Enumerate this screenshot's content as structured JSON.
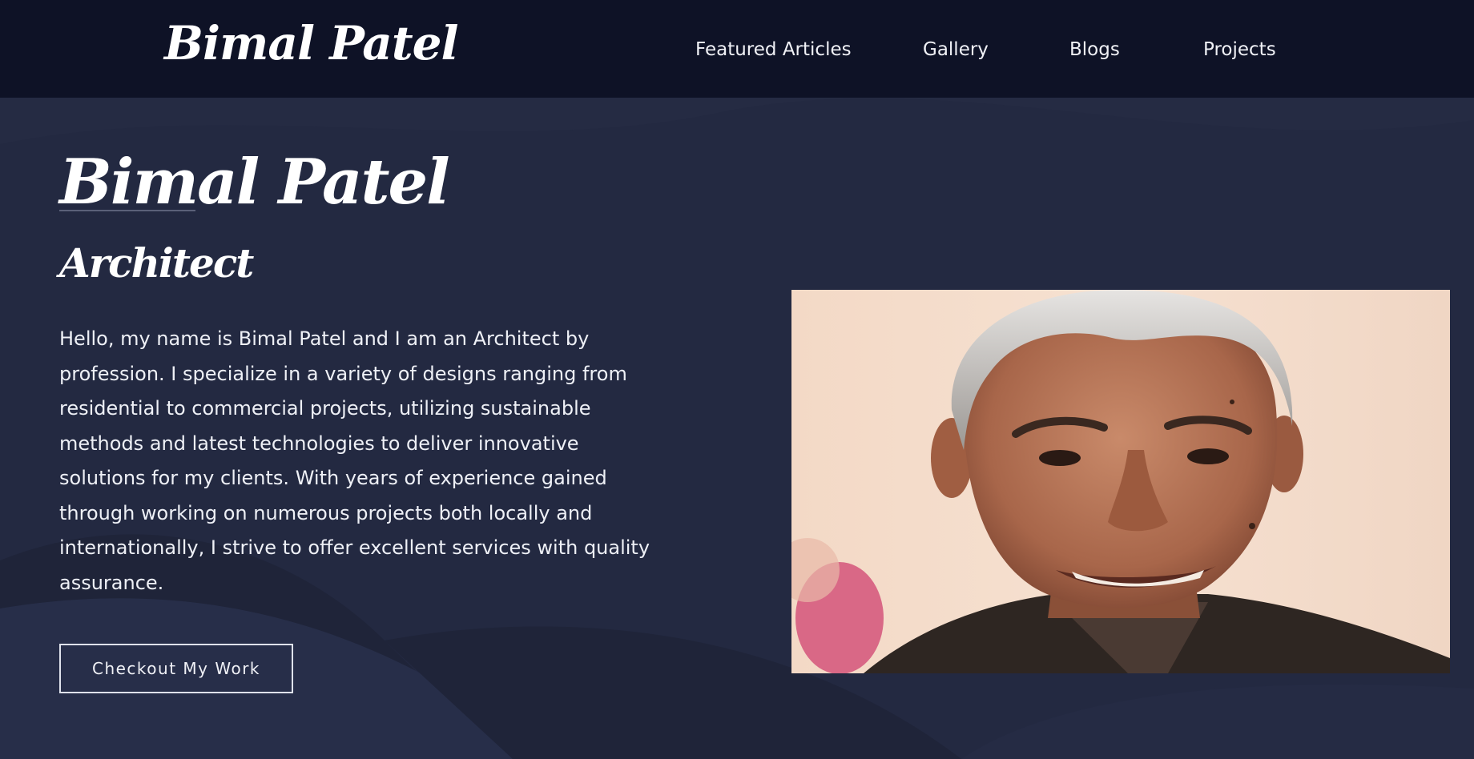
{
  "header": {
    "brand": "Bimal Patel",
    "nav": [
      {
        "label": "Featured Articles"
      },
      {
        "label": "Gallery"
      },
      {
        "label": "Blogs"
      },
      {
        "label": "Projects"
      }
    ]
  },
  "hero": {
    "name": "Bimal Patel",
    "role": "Architect",
    "bio": "Hello, my name is Bimal Patel and I am an Architect by profession. I specialize in a variety of designs ranging from residential to commercial projects, utilizing sustainable methods and latest technologies to deliver innovative solutions for my clients. With years of experience gained through working on numerous projects both locally and internationally, I strive to offer excellent services with quality assurance.",
    "cta_label": "Checkout My Work"
  },
  "colors": {
    "navbar_bg": "#0e1226",
    "page_bg": "#232941",
    "text": "#ffffff"
  }
}
